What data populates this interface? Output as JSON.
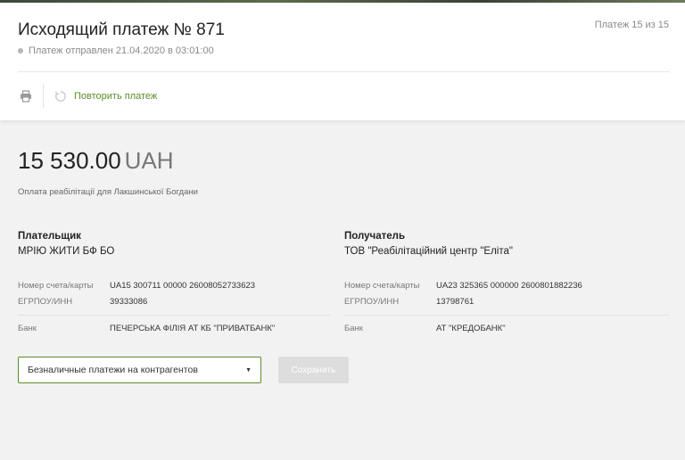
{
  "header": {
    "title": "Исходящий платеж № 871",
    "status": "Платеж отправлен 21.04.2020 в 03:01:00",
    "counter": "Платеж 15 из 15"
  },
  "toolbar": {
    "print_icon": "printer-icon",
    "repeat_icon": "refresh-icon",
    "repeat_label": "Повторить платеж"
  },
  "payment": {
    "amount": "15 530.00",
    "currency": "UAH",
    "purpose": "Оплата реабілітації для Лакшинської Богдани"
  },
  "payer": {
    "role": "Плательщик",
    "name": "МРІЮ ЖИТИ БФ БО",
    "account_label": "Номер счета/карты",
    "account_value": "UA15 300711 00000 26008052733623",
    "code_label": "ЕГРПОУ/ИНН",
    "code_value": "39333086",
    "bank_label": "Банк",
    "bank_value": "ПЕЧЕРСЬКА ФІЛІЯ АТ КБ \"ПРИВАТБАНК\""
  },
  "payee": {
    "role": "Получатель",
    "name": "ТОВ \"Реабілітаційний центр \"Еліта\"",
    "account_label": "Номер счета/карты",
    "account_value": "UA23 325365 000000 2600801882236",
    "code_label": "ЕГРПОУ/ИНН",
    "code_value": "13798761",
    "bank_label": "Банк",
    "bank_value": "АТ \"КРЕДОБАНК\""
  },
  "category": {
    "selected": "Безналичные платежи на контрагентов",
    "caret": "▼"
  },
  "actions": {
    "save_label": "Сохранить"
  },
  "colors": {
    "accent": "#5a8f2a",
    "muted": "#8a8a8a",
    "disabled_button": "#dddddd"
  }
}
